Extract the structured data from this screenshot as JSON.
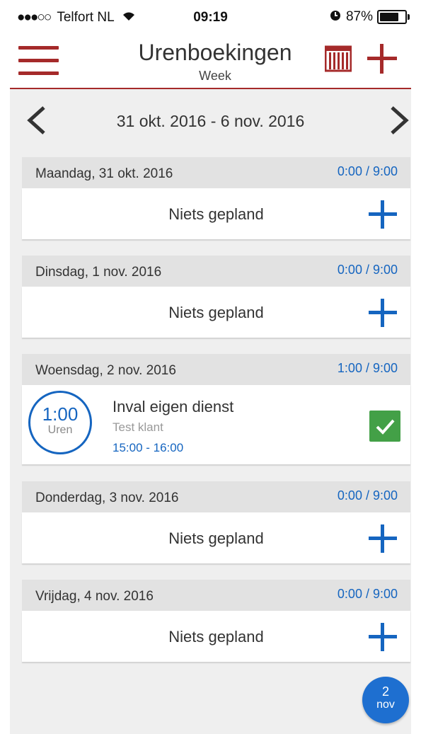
{
  "status_bar": {
    "signal": "●●●○○",
    "carrier": "Telfort NL",
    "time": "09:19",
    "battery_percent": "87%",
    "battery_level": 0.87
  },
  "header": {
    "title": "Urenboekingen",
    "subtitle": "Week",
    "accent_color": "#a52a2a"
  },
  "week_nav": {
    "range": "31 okt. 2016 - 6 nov. 2016"
  },
  "days": [
    {
      "label": "Maandag, 31 okt. 2016",
      "hours": "0:00 / 9:00",
      "empty_text": "Niets gepland"
    },
    {
      "label": "Dinsdag, 1 nov. 2016",
      "hours": "0:00 / 9:00",
      "empty_text": "Niets gepland"
    },
    {
      "label": "Woensdag, 2 nov. 2016",
      "hours": "1:00 / 9:00",
      "entry": {
        "duration": "1:00",
        "unit": "Uren",
        "title": "Inval eigen dienst",
        "client": "Test klant",
        "time_range": "15:00 - 16:00",
        "approved": true
      }
    },
    {
      "label": "Donderdag, 3 nov. 2016",
      "hours": "0:00 / 9:00",
      "empty_text": "Niets gepland"
    },
    {
      "label": "Vrijdag, 4 nov. 2016",
      "hours": "0:00 / 9:00",
      "empty_text": "Niets gepland"
    }
  ],
  "today_badge": {
    "day": "2",
    "month": "nov"
  },
  "colors": {
    "link_blue": "#1565c0",
    "check_green": "#43a047",
    "background": "#efefef"
  }
}
